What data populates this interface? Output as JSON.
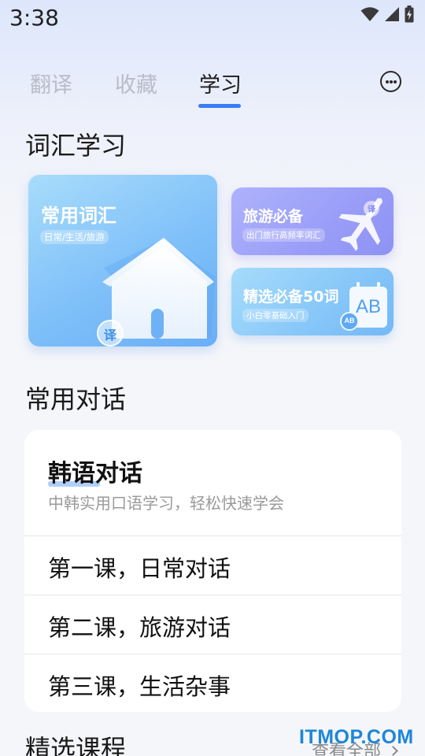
{
  "status_bar": {
    "time": "3:38",
    "icons": [
      "wifi-icon",
      "signal-icon",
      "battery-charging-icon"
    ]
  },
  "tabs": [
    {
      "label": "翻译",
      "active": false
    },
    {
      "label": "收藏",
      "active": false
    },
    {
      "label": "学习",
      "active": true
    }
  ],
  "more_icon": "more-horizontal-icon",
  "vocab_section": {
    "title": "词汇学习",
    "cards": [
      {
        "title": "常用词汇",
        "subtitle": "日常/生活/旅游",
        "badge": "译",
        "icon": "house-icon"
      },
      {
        "title": "旅游必备",
        "subtitle": "出门旅行高频率词汇",
        "badge": "译",
        "icon": "airplane-icon"
      },
      {
        "title": "精选必备50词",
        "subtitle": "小白零基础入门",
        "badge_small": "AB",
        "badge_big": "AB",
        "icon": "calendar-ab-icon"
      }
    ]
  },
  "dialog_section": {
    "title": "常用对话",
    "card": {
      "title": "韩语对话",
      "subtitle": "中韩实用口语学习，轻松快速学会",
      "lessons": [
        "第一课，日常对话",
        "第二课，旅游对话",
        "第三课，生活杂事"
      ]
    }
  },
  "courses_section": {
    "title": "精选课程",
    "see_all": "查看全部"
  },
  "watermark": "ITMOP.COM",
  "colors": {
    "accent": "#3a7cf6",
    "tab_inactive": "#b7bcc8"
  }
}
